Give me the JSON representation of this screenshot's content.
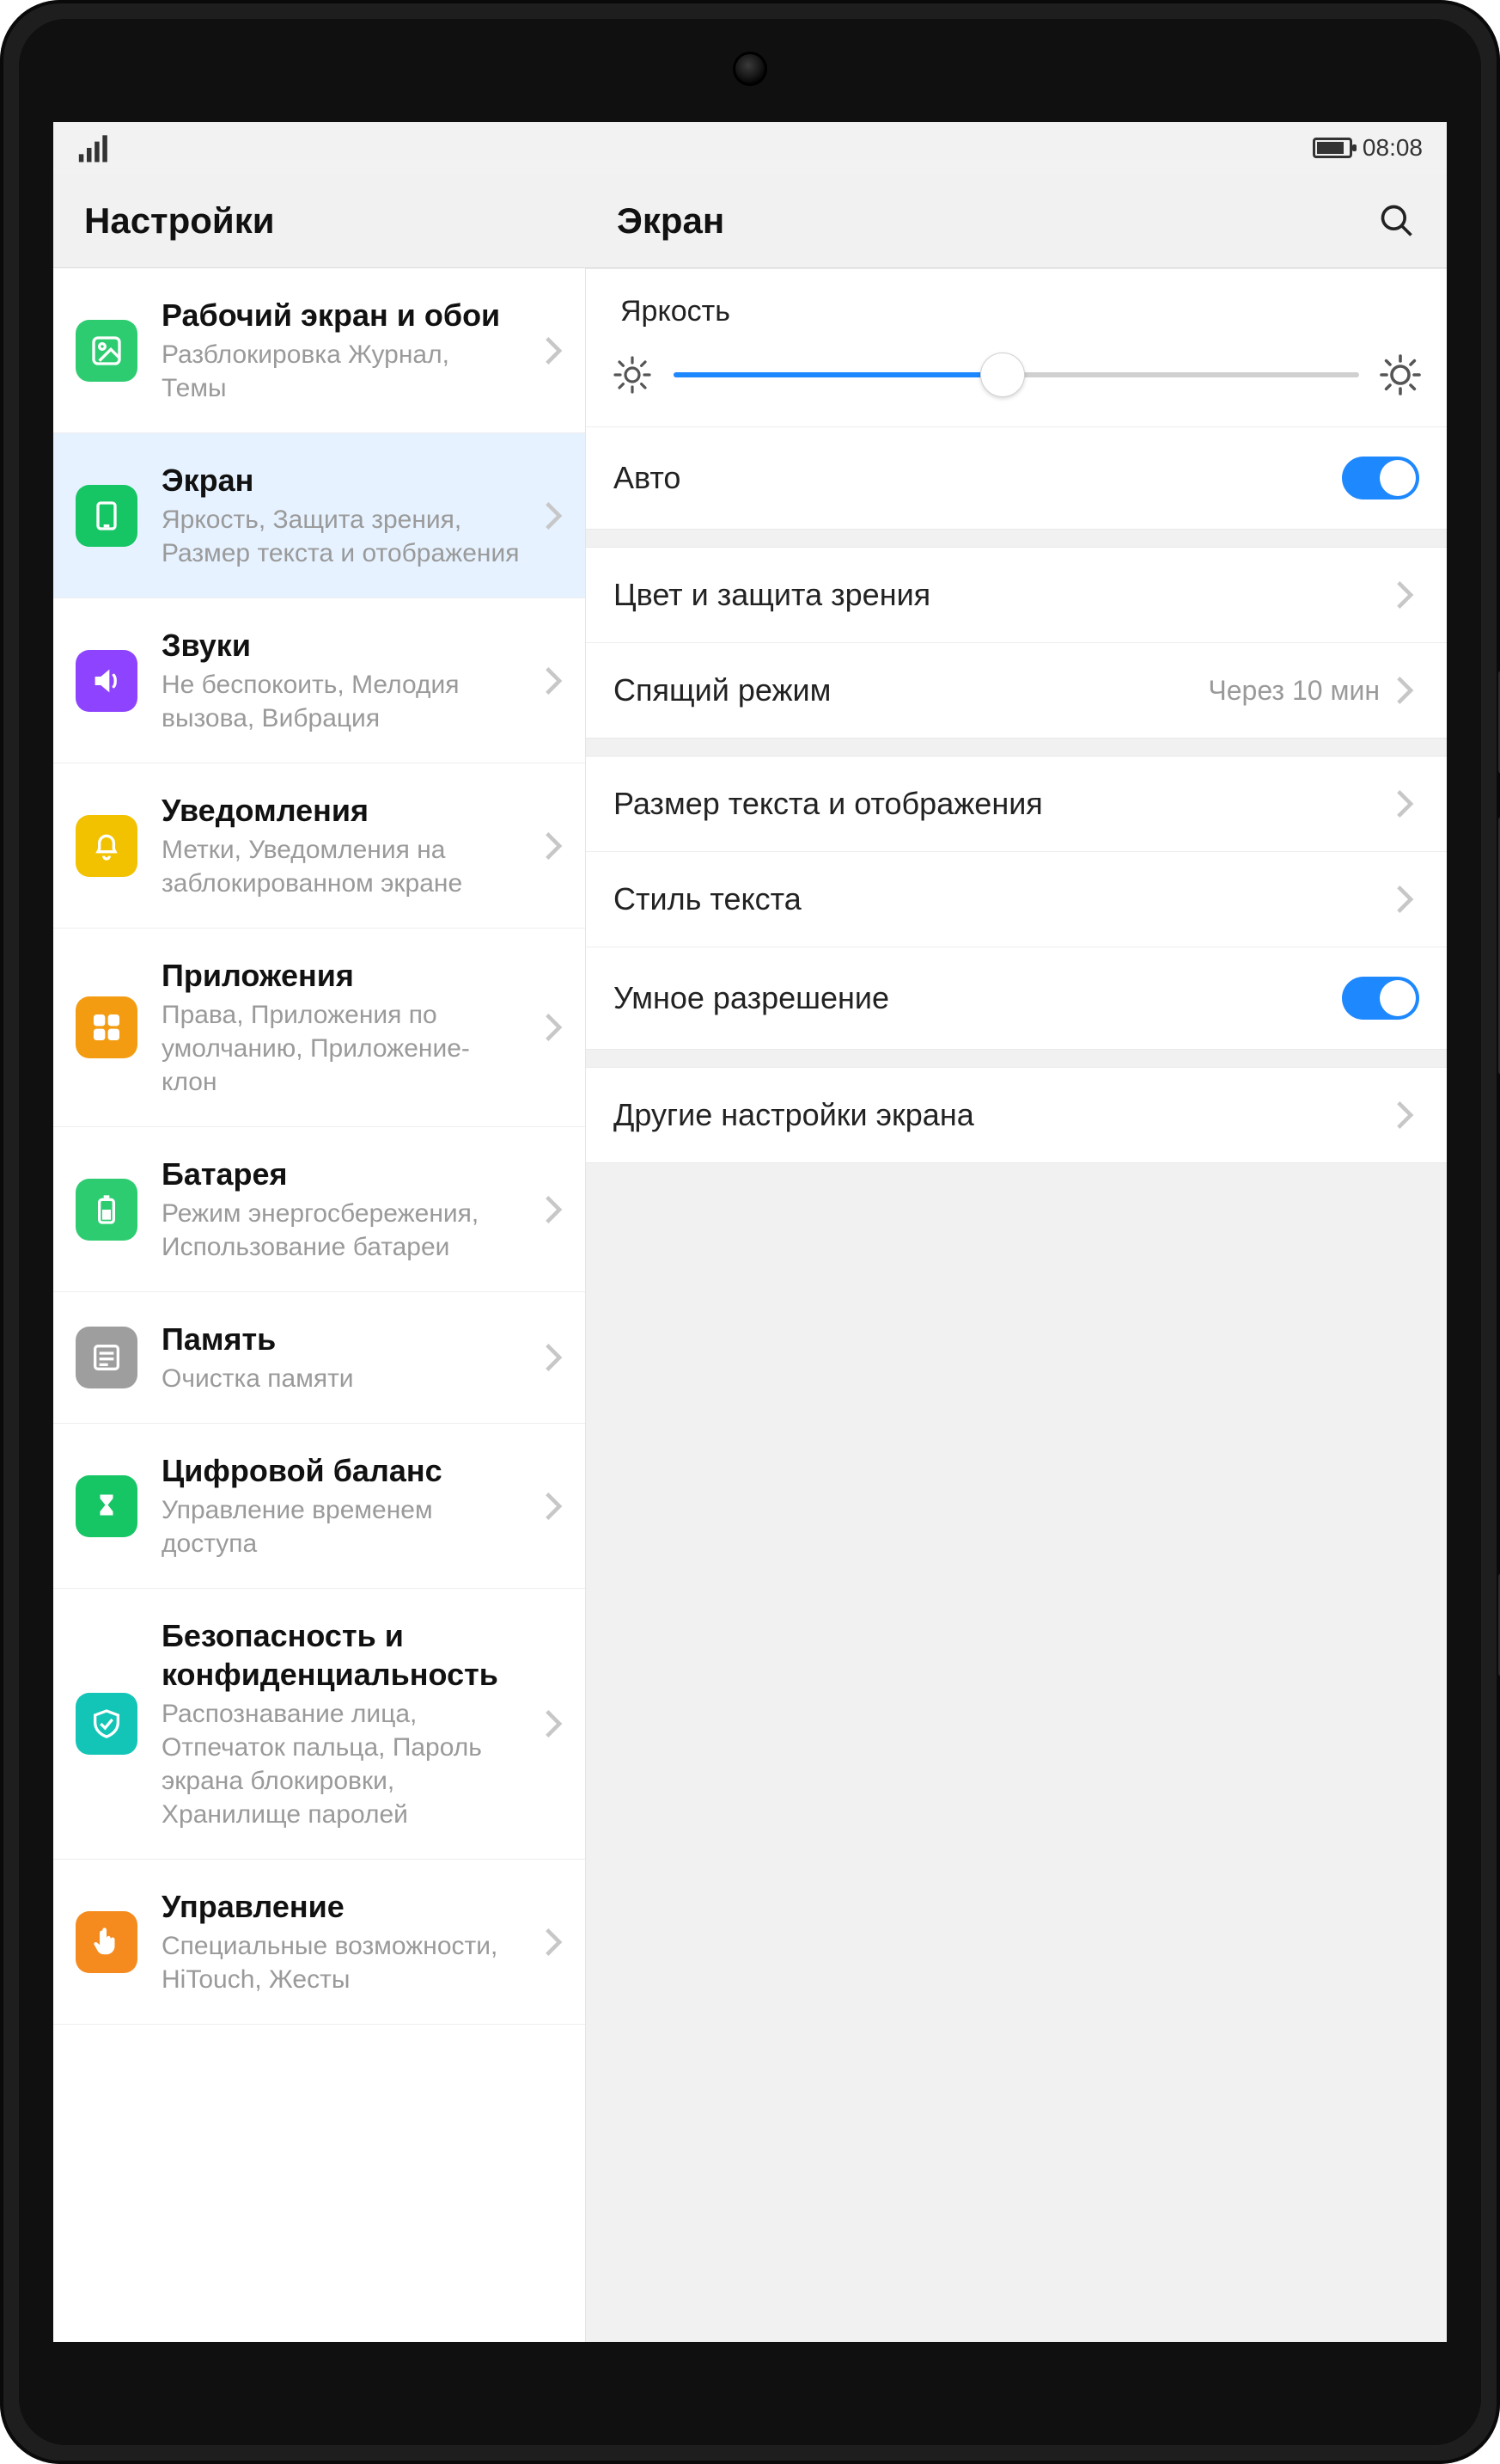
{
  "status": {
    "time": "08:08"
  },
  "header": {
    "settings_title": "Настройки",
    "detail_title": "Экран"
  },
  "sidebar": {
    "items": [
      {
        "icon": "wallpaper-icon",
        "bg": "bg-green",
        "title": "Рабочий экран и обои",
        "sub": "Разблокировка Журнал, Темы"
      },
      {
        "icon": "display-icon",
        "bg": "bg-green2",
        "title": "Экран",
        "sub": "Яркость, Защита зрения, Размер текста и отображения",
        "selected": true
      },
      {
        "icon": "sound-icon",
        "bg": "bg-purple",
        "title": "Звуки",
        "sub": "Не беспокоить, Мелодия вызова, Вибрация"
      },
      {
        "icon": "bell-icon",
        "bg": "bg-yellow",
        "title": "Уведомления",
        "sub": "Метки, Уведомления на заблокированном экране"
      },
      {
        "icon": "apps-icon",
        "bg": "bg-orange",
        "title": "Приложения",
        "sub": "Права, Приложения по умолчанию, Приложение-клон"
      },
      {
        "icon": "battery-icon",
        "bg": "bg-green",
        "title": "Батарея",
        "sub": "Режим энергосбережения, Использование батареи"
      },
      {
        "icon": "storage-icon",
        "bg": "bg-grey",
        "title": "Память",
        "sub": "Очистка памяти"
      },
      {
        "icon": "hourglass-icon",
        "bg": "bg-green2",
        "title": "Цифровой баланс",
        "sub": "Управление временем доступа"
      },
      {
        "icon": "shield-icon",
        "bg": "bg-teal",
        "title": "Безопасность и конфиденциальность",
        "sub": "Распознавание лица, Отпечаток пальца, Пароль экрана блокировки, Хранилище паролей"
      },
      {
        "icon": "hand-icon",
        "bg": "bg-orange2",
        "title": "Управление",
        "sub": "Специальные возможности, HiTouch, Жесты"
      }
    ]
  },
  "content": {
    "brightness_label": "Яркость",
    "brightness_percent": 48,
    "rows": {
      "auto": {
        "label": "Авто",
        "on": true
      },
      "color": {
        "label": "Цвет и защита зрения"
      },
      "sleep": {
        "label": "Спящий режим",
        "value": "Через 10 мин"
      },
      "size": {
        "label": "Размер текста и отображения"
      },
      "style": {
        "label": "Стиль текста"
      },
      "smart": {
        "label": "Умное разрешение",
        "on": true
      },
      "other": {
        "label": "Другие настройки экрана"
      }
    }
  }
}
